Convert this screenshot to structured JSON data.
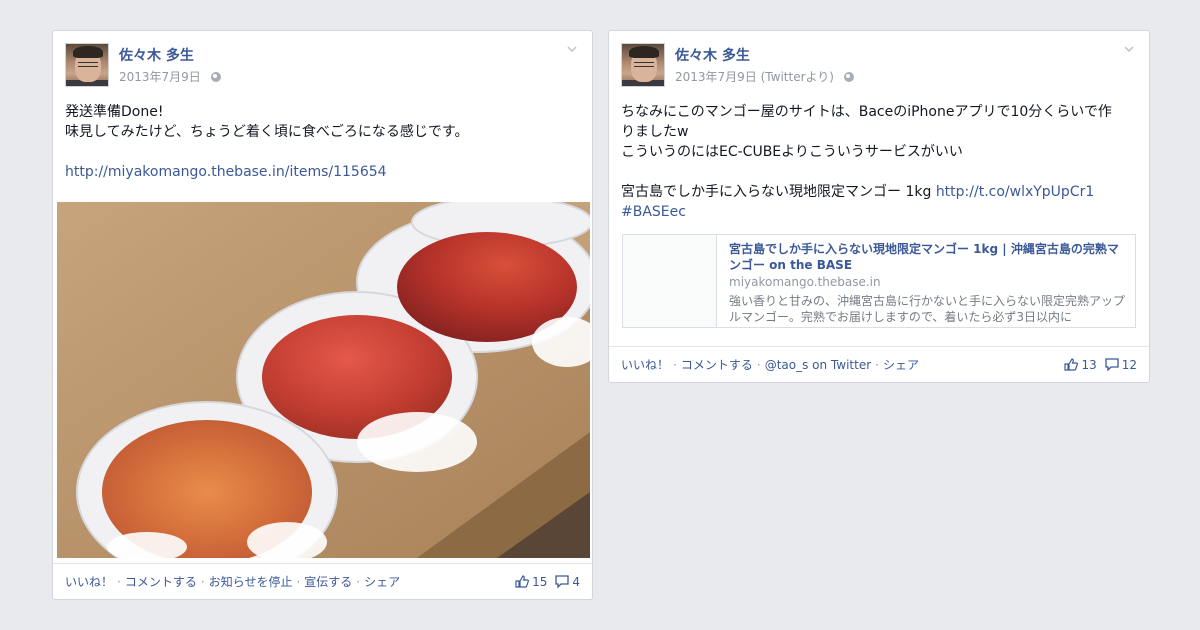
{
  "posts": [
    {
      "author": "佐々木 多生",
      "date": "2013年7月9日",
      "lines": [
        "発送準備Done!",
        "味見してみたけど、ちょうど着く頃に食べごろになる感じです。",
        "",
        "http://miyakomango.thebase.in/items/115654"
      ],
      "link": "http://miyakomango.thebase.in/items/115654",
      "actions": [
        "いいね！",
        "コメントする",
        "お知らせを停止",
        "宣伝する",
        "シェア"
      ],
      "likes": "15",
      "comments": "4"
    },
    {
      "author": "佐々木 多生",
      "date": "2013年7月9日 (Twitterより)",
      "lines": [
        "ちなみにこのマンゴー屋のサイトは、BaceのiPhoneアプリで10分くらいで作",
        "りましたw",
        "こういうのにはEC-CUBEよりこういうサービスがいい",
        "",
        "宮古島でしか手に入らない現地限定マンゴー 1kg "
      ],
      "tweet_link": "http://t.co/wlxYpUpCr1",
      "hashtag": "#BASEec",
      "preview": {
        "title": "宮古島でしか手に入らない現地限定マンゴー 1kg | 沖縄宮古島の完熟マンゴー on the BASE",
        "domain": "miyakomango.thebase.in",
        "description": "強い香りと甘みの、沖縄宮古島に行かないと手に入らない限定完熟アップルマンゴー。完熟でお届けしますので、着いたら必ず3日以内に"
      },
      "actions": [
        "いいね！",
        "コメントする",
        "@tao_s on Twitter",
        "シェア"
      ],
      "likes": "13",
      "comments": "12"
    }
  ],
  "icons": {
    "privacy": "globe-icon",
    "menu": "chevron-down-icon",
    "like": "thumbs-up-icon",
    "comment": "comment-bubble-icon"
  },
  "colors": {
    "background": "#e9eaed",
    "link": "#3b5998",
    "meta": "#9197a3"
  }
}
